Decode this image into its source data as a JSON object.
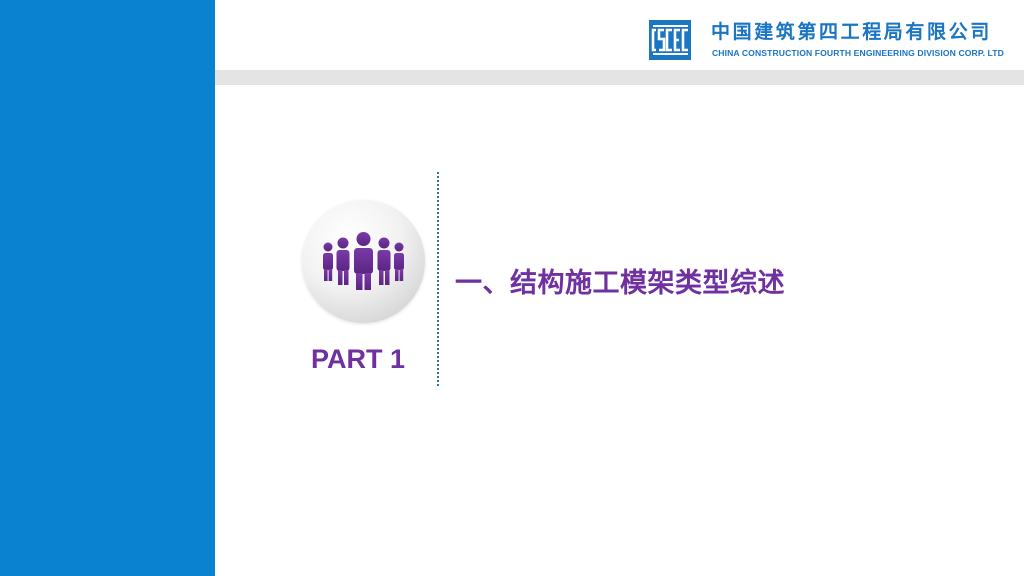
{
  "header": {
    "company_cn": "中国建筑第四工程局有限公司",
    "company_en": "CHINA CONSTRUCTION FOURTH ENGINEERING DIVISION CORP. LTD",
    "logo_icon": "cscec-logo-icon"
  },
  "section": {
    "part": "PART 1",
    "title": "一、结构施工模架类型综述",
    "icon": "people-group-icon"
  },
  "colors": {
    "sidebar": "#0a82cf",
    "brand_blue": "#1a75c2",
    "accent_purple": "#7030a0",
    "header_band": "#e4e4e4"
  }
}
